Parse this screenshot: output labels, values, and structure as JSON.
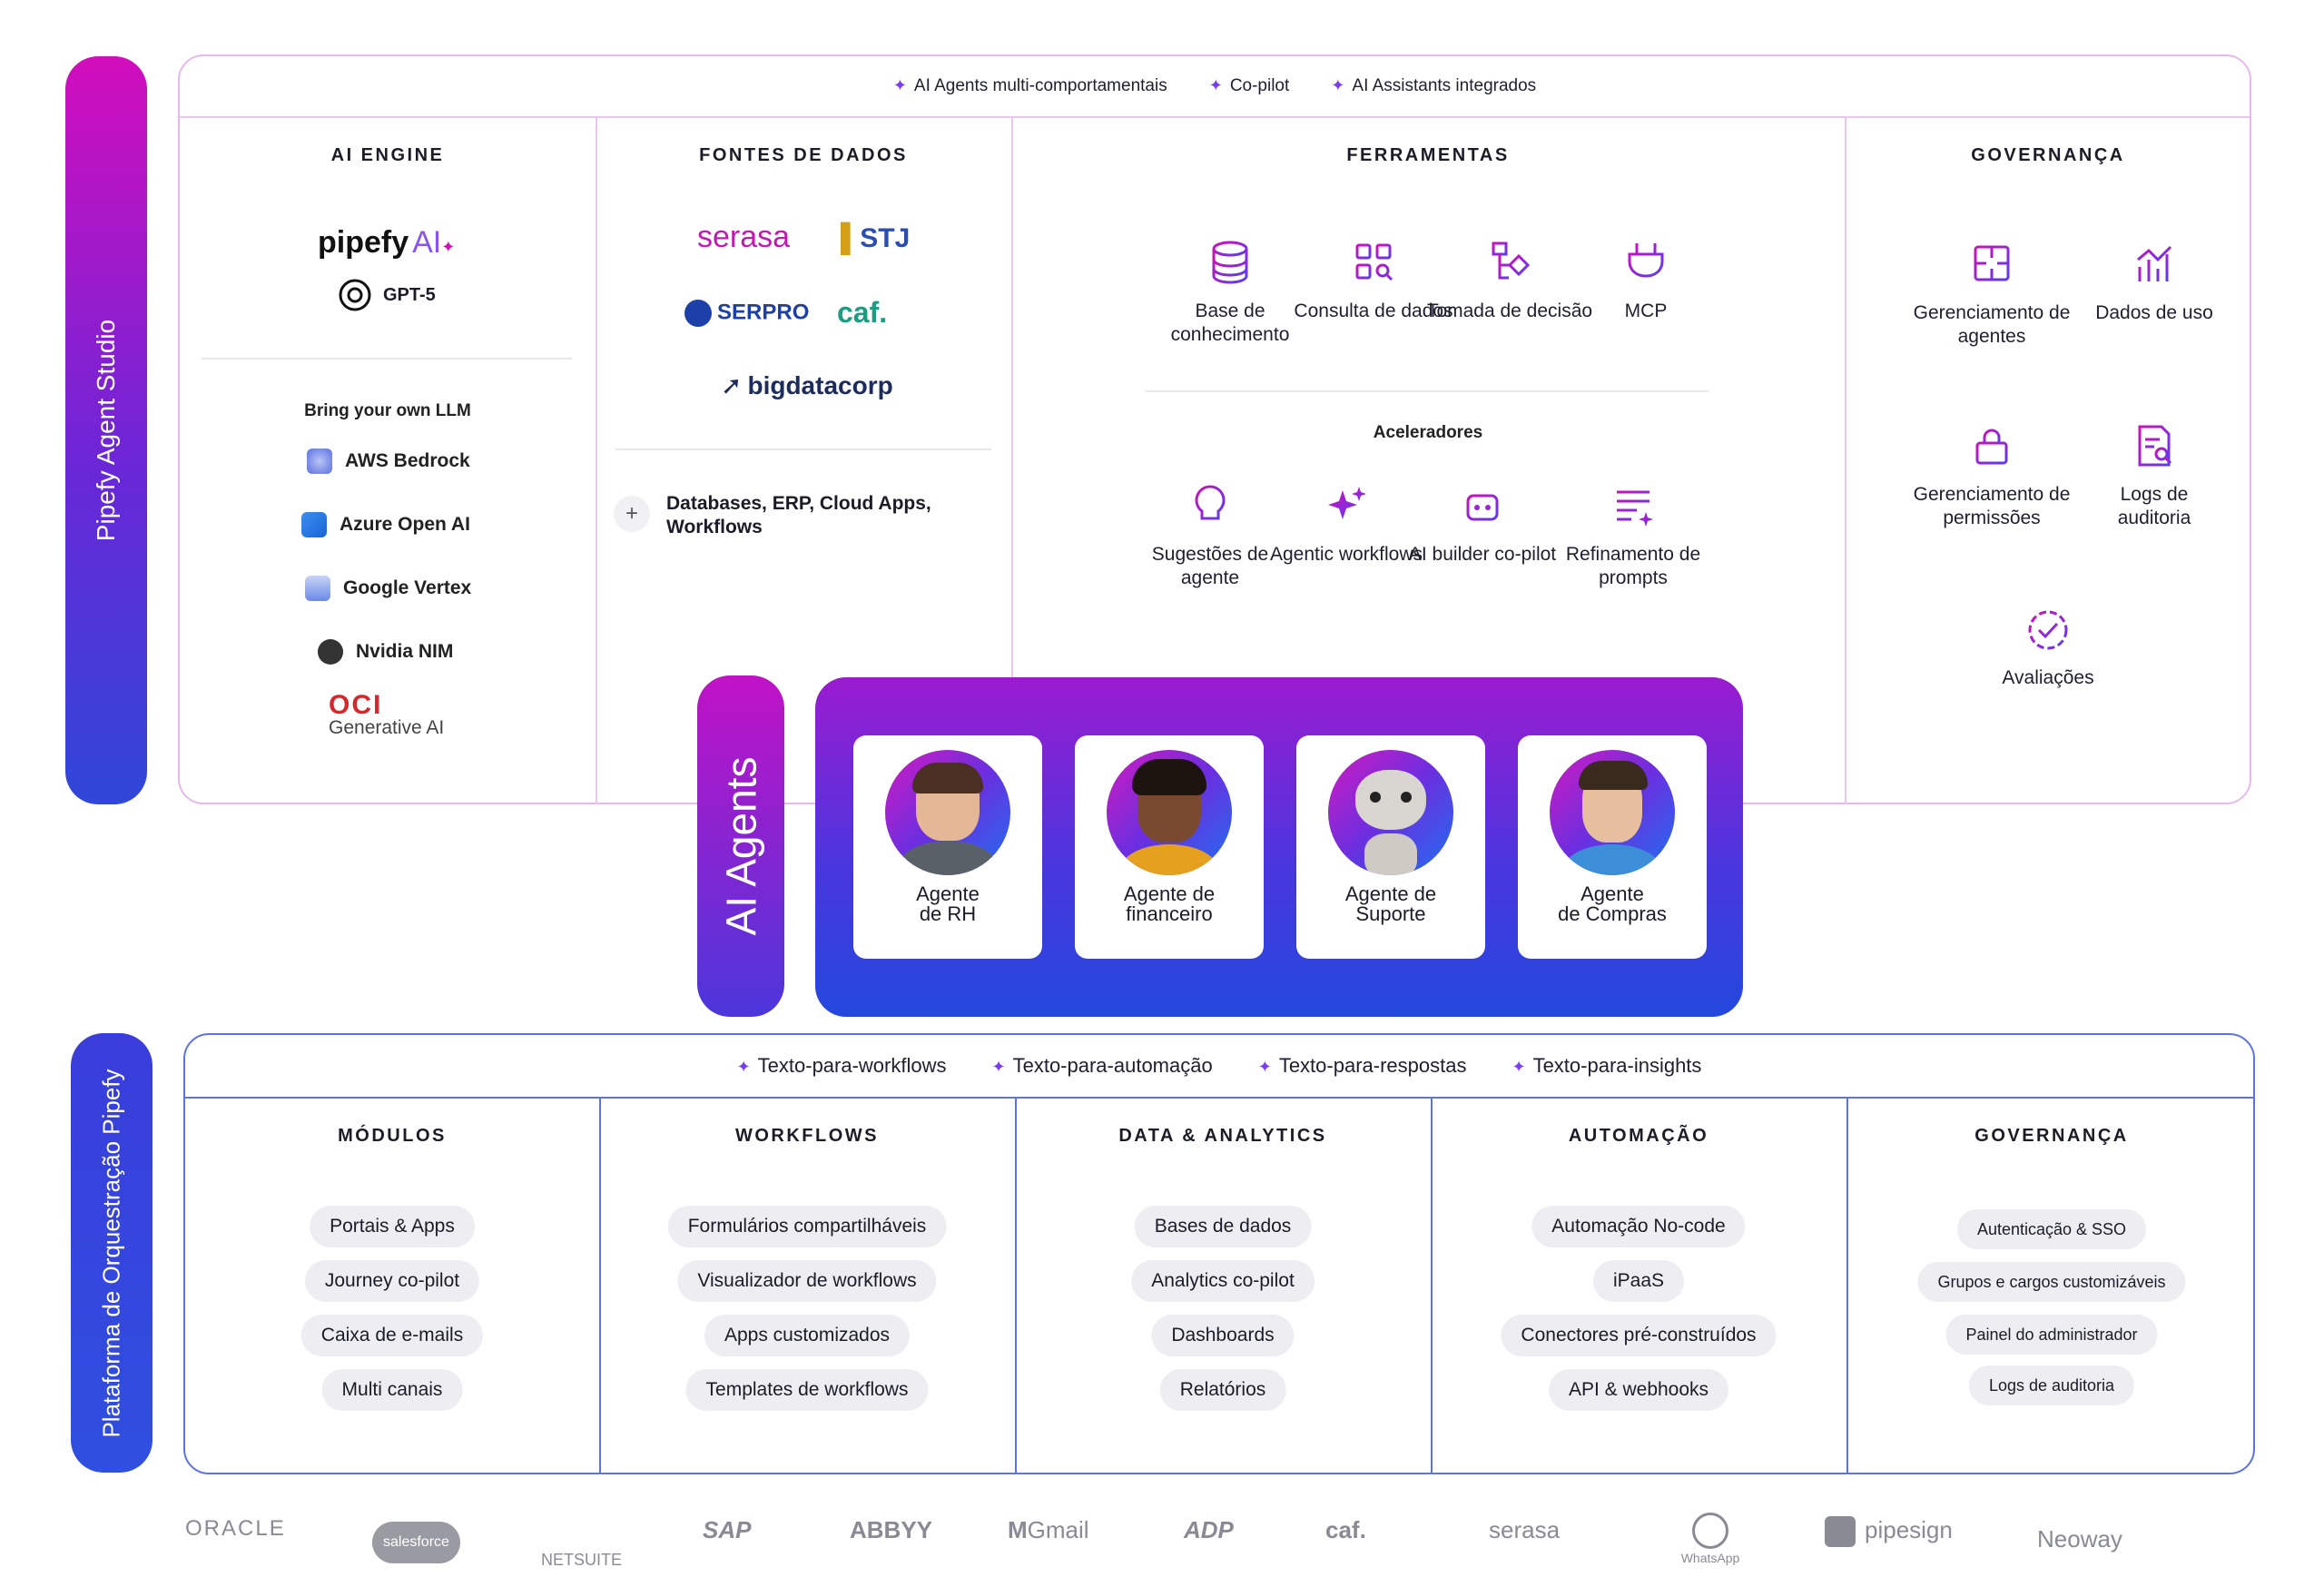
{
  "studio": {
    "bar_label": "Pipefy Agent Studio",
    "top_items": [
      "AI Agents multi-comportamentais",
      "Co-pilot",
      "AI Assistants integrados"
    ],
    "ai_engine": {
      "title": "AI ENGINE",
      "pipefy_ai": "pipefy",
      "pipefy_ai_suffix": "AI",
      "gpt": "GPT-5",
      "byo_label": "Bring your own LLM",
      "providers": [
        "AWS Bedrock",
        "Azure Open AI",
        "Google Vertex",
        "Nvidia NIM"
      ],
      "oci_logo": "OCI",
      "oci_sub": "Generative AI"
    },
    "fontes": {
      "title": "FONTES DE DADOS",
      "logos": [
        "serasa",
        "STJ",
        "SERPRO",
        "caf.",
        "bigdatacorp"
      ],
      "extra": "Databases, ERP, Cloud Apps, Workflows"
    },
    "ferramentas": {
      "title": "FERRAMENTAS",
      "tools": [
        {
          "label": "Base de conhecimento",
          "icon": "database-icon"
        },
        {
          "label": "Consulta de dados",
          "icon": "data-query-icon"
        },
        {
          "label": "Tomada de decisão",
          "icon": "decision-icon"
        },
        {
          "label": "MCP",
          "icon": "plug-icon"
        }
      ],
      "accel_title": "Aceleradores",
      "accelerators": [
        {
          "label": "Sugestões de agente",
          "icon": "lightbulb-icon"
        },
        {
          "label": "Agentic workflows",
          "icon": "sparkle-icon"
        },
        {
          "label": "AI builder co-pilot",
          "icon": "robot-icon"
        },
        {
          "label": "Refinamento de prompts",
          "icon": "prompt-icon"
        }
      ]
    },
    "governanca": {
      "title": "GOVERNANÇA",
      "items": [
        {
          "label": "Gerenciamento de agentes",
          "icon": "puzzle-icon"
        },
        {
          "label": "Dados de uso",
          "icon": "chart-icon"
        },
        {
          "label": "Gerenciamento de permissões",
          "icon": "lock-icon"
        },
        {
          "label": "Logs de auditoria",
          "icon": "log-search-icon"
        },
        {
          "label": "Avaliações",
          "icon": "check-badge-icon"
        }
      ]
    }
  },
  "agents": {
    "bar_label": "AI Agents",
    "cards": [
      {
        "l1": "Agente",
        "l2": "de RH"
      },
      {
        "l1": "Agente de",
        "l2": "financeiro"
      },
      {
        "l1": "Agente de",
        "l2": "Suporte"
      },
      {
        "l1": "Agente",
        "l2": "de Compras"
      }
    ]
  },
  "orchestration": {
    "bar_label": "Plataforma de Orquestração Pipefy",
    "top_items": [
      "Texto-para-workflows",
      "Texto-para-automação",
      "Texto-para-respostas",
      "Texto-para-insights"
    ],
    "columns": [
      {
        "title": "MÓDULOS",
        "items": [
          "Portais & Apps",
          "Journey co-pilot",
          "Caixa de e-mails",
          "Multi canais"
        ]
      },
      {
        "title": "WORKFLOWS",
        "items": [
          "Formulários compartilháveis",
          "Visualizador de workflows",
          "Apps customizados",
          "Templates de workflows"
        ]
      },
      {
        "title": "DATA & ANALYTICS",
        "items": [
          "Bases de dados",
          "Analytics co-pilot",
          "Dashboards",
          "Relatórios"
        ]
      },
      {
        "title": "AUTOMAÇÃO",
        "items": [
          "Automação No-code",
          "iPaaS",
          "Conectores pré-construídos",
          "API & webhooks"
        ]
      },
      {
        "title": "GOVERNANÇA",
        "items": [
          "Autenticação & SSO",
          "Grupos e cargos customizáveis",
          "Painel do administrador",
          "Logs de auditoria"
        ]
      }
    ]
  },
  "partners": [
    "ORACLE",
    "salesforce",
    "NETSUITE",
    "SAP",
    "ABBYY",
    "Gmail",
    "ADP",
    "caf.",
    "serasa",
    "WhatsApp",
    "pipesign",
    "Neoway"
  ],
  "colors": {
    "magenta": "#d20dbc",
    "purple": "#6a27d8",
    "blue": "#2f47d9",
    "icon": "#7a3cf0"
  }
}
